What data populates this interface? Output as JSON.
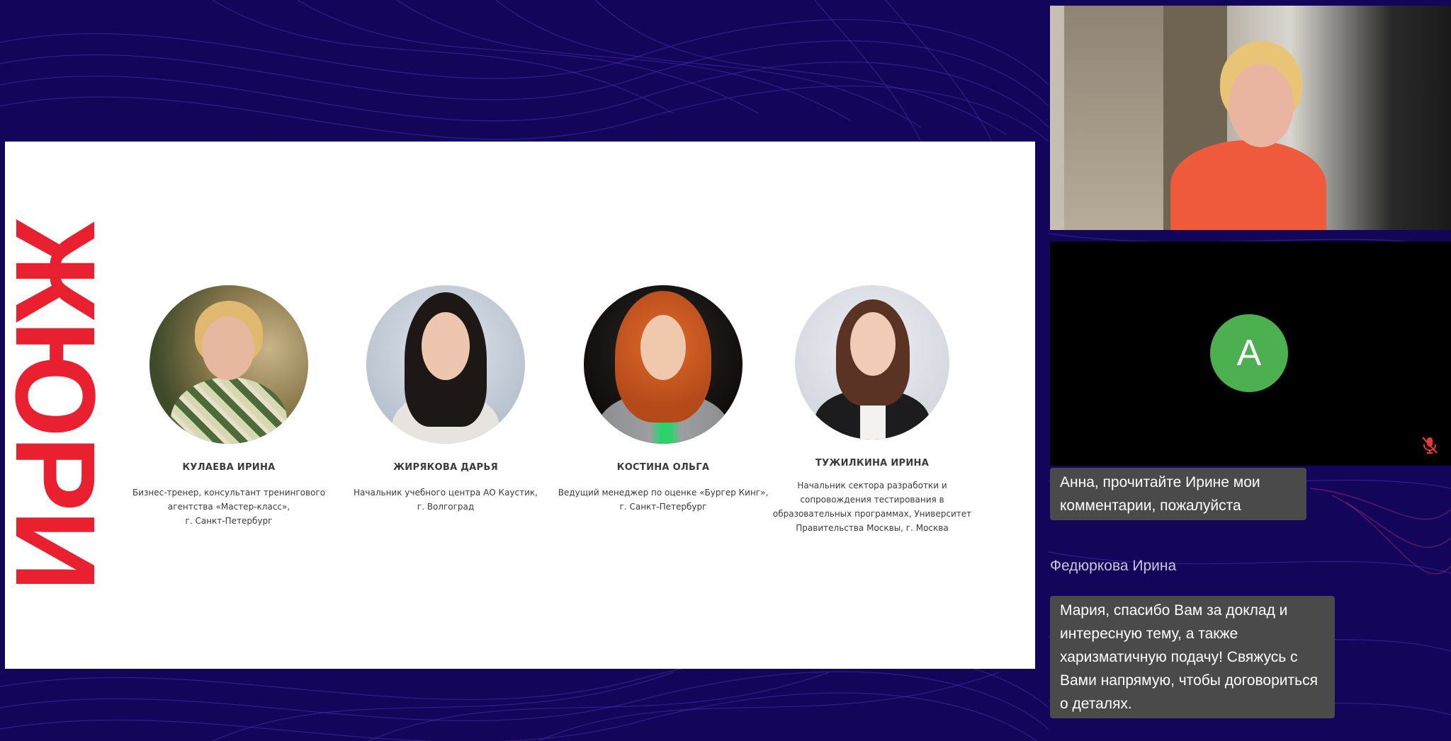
{
  "slide": {
    "title": "ЖЮРИ",
    "jurors": [
      {
        "name": "КУЛАЕВА ИРИНА",
        "description": "Бизнес-тренер, консультант тренингового агентства «Мастер-класс»,\nг. Санкт-Петербург"
      },
      {
        "name": "ЖИРЯКОВА ДАРЬЯ",
        "description": "Начальник учебного центра АО Каустик,\nг. Волгоград"
      },
      {
        "name": "КОСТИНА ОЛЬГА",
        "description": "Ведущий менеджер по оценке «Бургер Кинг», г. Санкт-Петербург"
      },
      {
        "name": "ТУЖИЛКИНА ИРИНА",
        "description": "Начальник сектора разработки и сопровождения тестирования в образовательных программах, Университет Правительства Москвы, г. Москва"
      }
    ]
  },
  "participants": {
    "tile2_avatar_letter": "А"
  },
  "chat": {
    "messages": [
      {
        "author": "",
        "text": "Анна, прочитайте Ирине мои комментарии, пожалуйста"
      },
      {
        "author": "Федюркова Ирина",
        "text": "Мария, спасибо Вам за доклад и интересную тему, а также харизматичную подачу! Свяжусь с Вами напрямую, чтобы договориться о деталях."
      }
    ]
  },
  "colors": {
    "background": "#13065a",
    "accent_red": "#e8202f",
    "avatar_green": "#4caf50",
    "mic_off_red": "#e53935",
    "chat_bubble": "#4a4a4a"
  },
  "icons": {
    "mic": "mic-off-icon"
  }
}
